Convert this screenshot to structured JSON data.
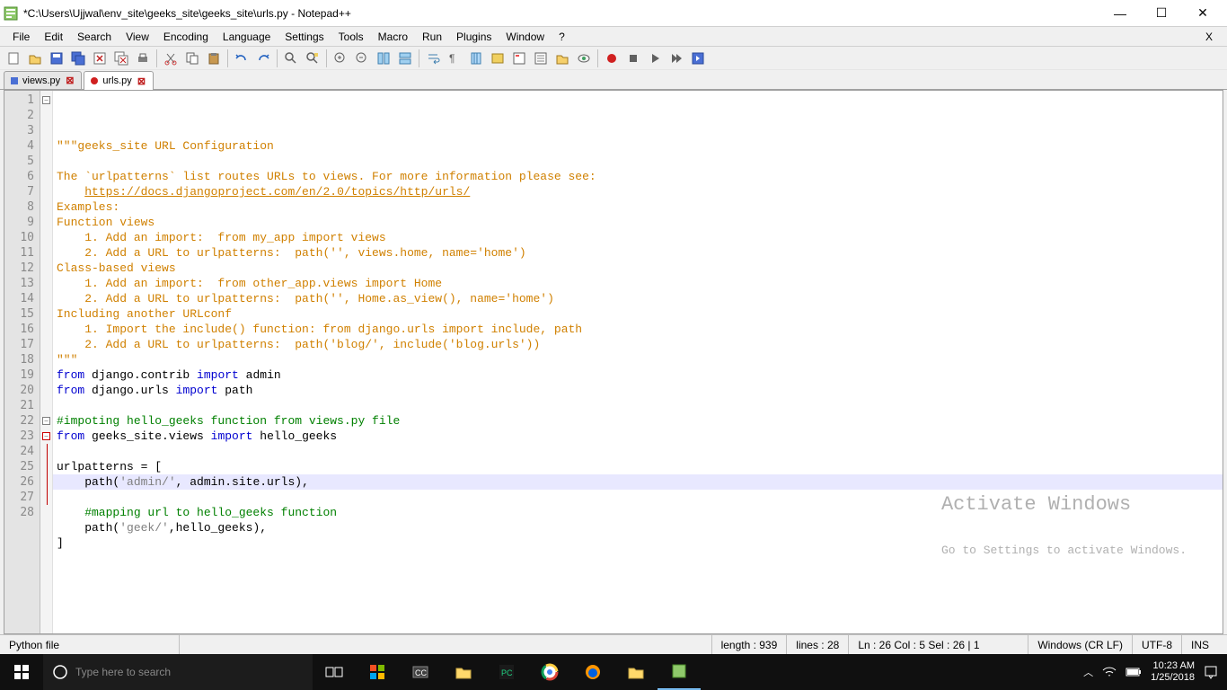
{
  "title": "*C:\\Users\\Ujjwal\\env_site\\geeks_site\\geeks_site\\urls.py - Notepad++",
  "menu": [
    "File",
    "Edit",
    "Search",
    "View",
    "Encoding",
    "Language",
    "Settings",
    "Tools",
    "Macro",
    "Run",
    "Plugins",
    "Window",
    "?"
  ],
  "tabs": [
    {
      "name": "views.py",
      "active": false
    },
    {
      "name": "urls.py",
      "active": true
    }
  ],
  "gutter_lines": 28,
  "highlight_line": 26,
  "code_lines": [
    {
      "t": "doc",
      "v": "\"\"\"geeks_site URL Configuration"
    },
    {
      "t": "doc",
      "v": ""
    },
    {
      "t": "doc",
      "v": "The `urlpatterns` list routes URLs to views. For more information please see:"
    },
    {
      "t": "link",
      "v": "    https://docs.djangoproject.com/en/2.0/topics/http/urls/"
    },
    {
      "t": "doc",
      "v": "Examples:"
    },
    {
      "t": "doc",
      "v": "Function views"
    },
    {
      "t": "doc",
      "v": "    1. Add an import:  from my_app import views"
    },
    {
      "t": "doc",
      "v": "    2. Add a URL to urlpatterns:  path('', views.home, name='home')"
    },
    {
      "t": "doc",
      "v": "Class-based views"
    },
    {
      "t": "doc",
      "v": "    1. Add an import:  from other_app.views import Home"
    },
    {
      "t": "doc",
      "v": "    2. Add a URL to urlpatterns:  path('', Home.as_view(), name='home')"
    },
    {
      "t": "doc",
      "v": "Including another URLconf"
    },
    {
      "t": "doc",
      "v": "    1. Import the include() function: from django.urls import include, path"
    },
    {
      "t": "doc",
      "v": "    2. Add a URL to urlpatterns:  path('blog/', include('blog.urls'))"
    },
    {
      "t": "doc",
      "v": "\"\"\""
    },
    {
      "t": "imp",
      "pre": "from",
      "m": " django.contrib ",
      "kw": "import",
      "post": " admin"
    },
    {
      "t": "imp",
      "pre": "from",
      "m": " django.urls ",
      "kw": "import",
      "post": " path"
    },
    {
      "t": "blank",
      "v": ""
    },
    {
      "t": "cm",
      "v": "#impoting hello_geeks function from views.py file"
    },
    {
      "t": "imp",
      "pre": "from",
      "m": " geeks_site.views ",
      "kw": "import",
      "post": " hello_geeks"
    },
    {
      "t": "blank",
      "v": ""
    },
    {
      "t": "plain",
      "v": "urlpatterns = ["
    },
    {
      "t": "path",
      "v": "    path('admin/', admin.site.urls),",
      "s": "'admin/'"
    },
    {
      "t": "blank",
      "v": ""
    },
    {
      "t": "cm",
      "v": "    #mapping url to hello_geeks function"
    },
    {
      "t": "path",
      "v": "    path('geek/',hello_geeks),",
      "s": "'geek/'"
    },
    {
      "t": "plain",
      "v": "]"
    },
    {
      "t": "blank",
      "v": ""
    }
  ],
  "status": {
    "lang": "Python file",
    "length": "length : 939",
    "lines": "lines : 28",
    "pos": "Ln : 26   Col : 5   Sel : 26 | 1",
    "eol": "Windows (CR LF)",
    "enc": "UTF-8",
    "mode": "INS"
  },
  "watermark": {
    "l1": "Activate Windows",
    "l2": "Go to Settings to activate Windows."
  },
  "taskbar": {
    "search_placeholder": "Type here to search",
    "time": "10:23 AM",
    "date": "1/25/2018"
  }
}
